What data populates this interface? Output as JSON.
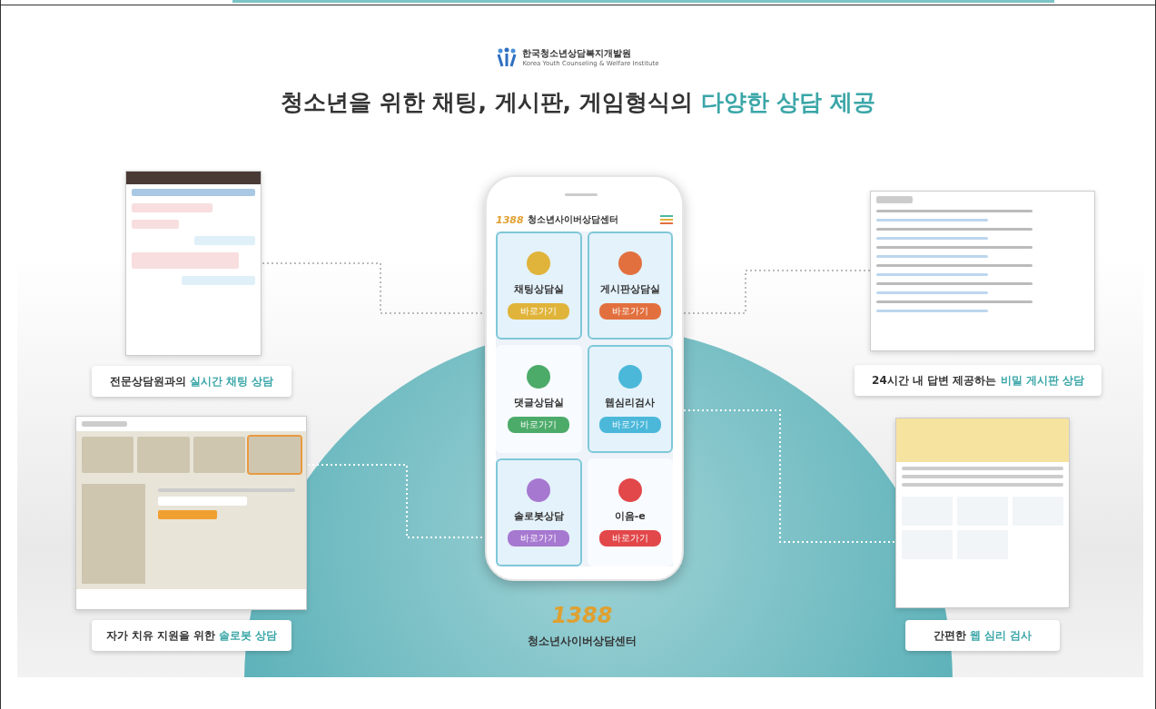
{
  "header": {
    "org_name": "한국청소년상담복지개발원",
    "org_name_en": "Korea Youth Counseling & Welfare Institute",
    "headline": "청소년을 위한 채팅, 게시판, 게임형식의",
    "headline_highlight": "다양한 상담 제공"
  },
  "phone": {
    "app_title": "청소년사이버상담센터",
    "logo_text": "1388",
    "cards": [
      {
        "title": "채팅상담실",
        "button": "바로가기",
        "color": "#e0b43a",
        "highlighted": true
      },
      {
        "title": "게시판상담실",
        "button": "바로가기",
        "color": "#e2703f",
        "highlighted": true
      },
      {
        "title": "댓글상담실",
        "button": "바로가기",
        "color": "#4dab6a",
        "highlighted": false
      },
      {
        "title": "웹심리검사",
        "button": "바로가기",
        "color": "#4bb8da",
        "highlighted": true
      },
      {
        "title": "솔로봇상담",
        "button": "바로가기",
        "color": "#a678d0",
        "highlighted": true
      },
      {
        "title": "이음-e",
        "button": "바로가기",
        "color": "#e2474a",
        "highlighted": false
      }
    ]
  },
  "features": [
    {
      "kind": "chat",
      "caption": "전문상담원과의",
      "highlight": "실시간 채팅 상담"
    },
    {
      "kind": "board",
      "caption": "24시간 내 답변 제공하는",
      "highlight": "비밀 게시판 상담"
    },
    {
      "kind": "solobot",
      "caption": "자가 치유 지원을 위한",
      "highlight": "솔로봇 상담"
    },
    {
      "kind": "test",
      "caption": "간편한",
      "highlight": "웹 심리 검사"
    }
  ],
  "footer": {
    "logo_text": "1388",
    "center_name": "청소년사이버상담센터"
  }
}
